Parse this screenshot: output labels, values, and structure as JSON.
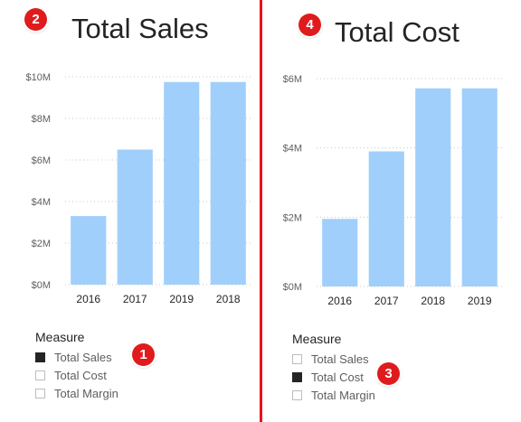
{
  "colors": {
    "bar": "#a0cffb",
    "accent": "#e8121a",
    "badge": "#df1b1e",
    "text": "#252423",
    "muted": "#605e5c"
  },
  "left": {
    "title": "Total Sales",
    "badge": "2",
    "slicer_badge": "1",
    "slicer": {
      "header": "Measure",
      "items": [
        {
          "label": "Total Sales",
          "selected": true
        },
        {
          "label": "Total Cost",
          "selected": false
        },
        {
          "label": "Total Margin",
          "selected": false
        }
      ]
    }
  },
  "right": {
    "title": "Total Cost",
    "badge": "4",
    "slicer_badge": "3",
    "slicer": {
      "header": "Measure",
      "items": [
        {
          "label": "Total Sales",
          "selected": false
        },
        {
          "label": "Total Cost",
          "selected": true
        },
        {
          "label": "Total Margin",
          "selected": false
        }
      ]
    }
  },
  "chart_data": [
    {
      "type": "bar",
      "categories": [
        "2016",
        "2017",
        "2019",
        "2018"
      ],
      "values": [
        3.3,
        6.5,
        9.75,
        9.75
      ],
      "ylim": [
        0,
        10
      ],
      "yticks": [
        {
          "value": 0,
          "label": "$0M"
        },
        {
          "value": 2,
          "label": "$2M"
        },
        {
          "value": 4,
          "label": "$4M"
        },
        {
          "value": 6,
          "label": "$6M"
        },
        {
          "value": 8,
          "label": "$8M"
        },
        {
          "value": 10,
          "label": "$10M"
        }
      ],
      "title": "Total Sales",
      "grid": true,
      "bar_color": "#a0cffb"
    },
    {
      "type": "bar",
      "categories": [
        "2016",
        "2017",
        "2018",
        "2019"
      ],
      "values": [
        1.95,
        3.9,
        5.72,
        5.72
      ],
      "ylim": [
        0,
        6
      ],
      "yticks": [
        {
          "value": 0,
          "label": "$0M"
        },
        {
          "value": 2,
          "label": "$2M"
        },
        {
          "value": 4,
          "label": "$4M"
        },
        {
          "value": 6,
          "label": "$6M"
        }
      ],
      "title": "Total Cost",
      "grid": true,
      "bar_color": "#a0cffb"
    }
  ]
}
